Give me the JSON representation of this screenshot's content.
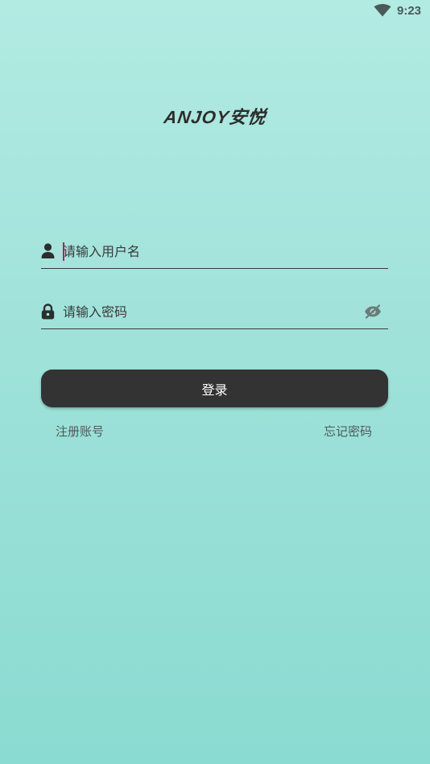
{
  "status_bar": {
    "time": "9:23",
    "wifi_icon": "wifi-icon"
  },
  "logo": {
    "text": "ANJOY安悦"
  },
  "username_field": {
    "icon": "user-icon",
    "placeholder": "请输入用户名",
    "value": ""
  },
  "password_field": {
    "icon": "lock-icon",
    "placeholder": "请输入密码",
    "value": "",
    "toggle_icon": "eye-off-icon"
  },
  "login_button": {
    "label": "登录"
  },
  "links": {
    "register": "注册账号",
    "forgot_password": "忘记密码"
  },
  "colors": {
    "background_top": "#b2ebe2",
    "background_bottom": "#8adbd1",
    "button": "#333333",
    "button_text": "#ffffff",
    "cursor": "#c2185b"
  }
}
